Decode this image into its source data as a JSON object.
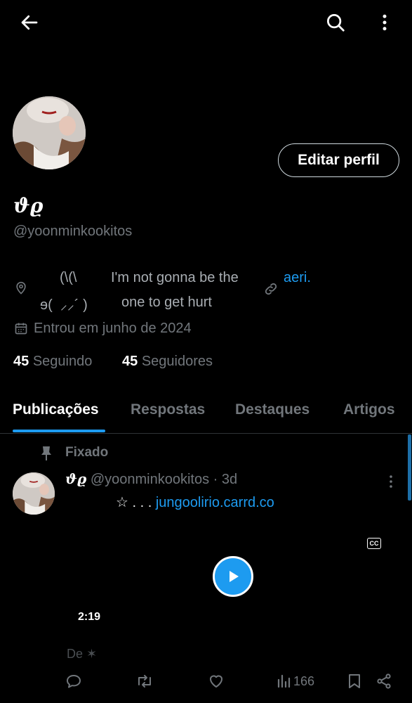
{
  "topbar": {
    "back_icon": "arrow-left-icon",
    "search_icon": "search-icon",
    "more_icon": "more-vertical-icon"
  },
  "profile": {
    "edit_button": "Editar perfil",
    "display_name": "ϑϱ",
    "handle": "@yoonminkookitos",
    "bio_line1": "(\\(\\",
    "bio_line2": "ɘ(  ⸝⸝´ )",
    "bio_text_line1": "I'm not gonna be the",
    "bio_text_line2": "one to get hurt",
    "website": "aeri.",
    "joined": "Entrou em junho de 2024",
    "following_count": "45",
    "following_label": "Seguindo",
    "followers_count": "45",
    "followers_label": "Seguidores"
  },
  "tabs": [
    "Publicações",
    "Respostas",
    "Destaques",
    "Artigos"
  ],
  "post": {
    "pinned_label": "Fixado",
    "author_name": "ϑϱ",
    "author_handle_time": "@yoonminkookitos · 3d",
    "text_prefix": "☆ . . . ",
    "text_link": "jungoolirio.carrd.co",
    "cc_label": "CC",
    "duration": "2:19",
    "caption": "De ✶",
    "views": "166"
  },
  "colors": {
    "background": "#000000",
    "accent": "#1d9bf0",
    "muted": "#71767b",
    "text": "#e7e9ea"
  }
}
